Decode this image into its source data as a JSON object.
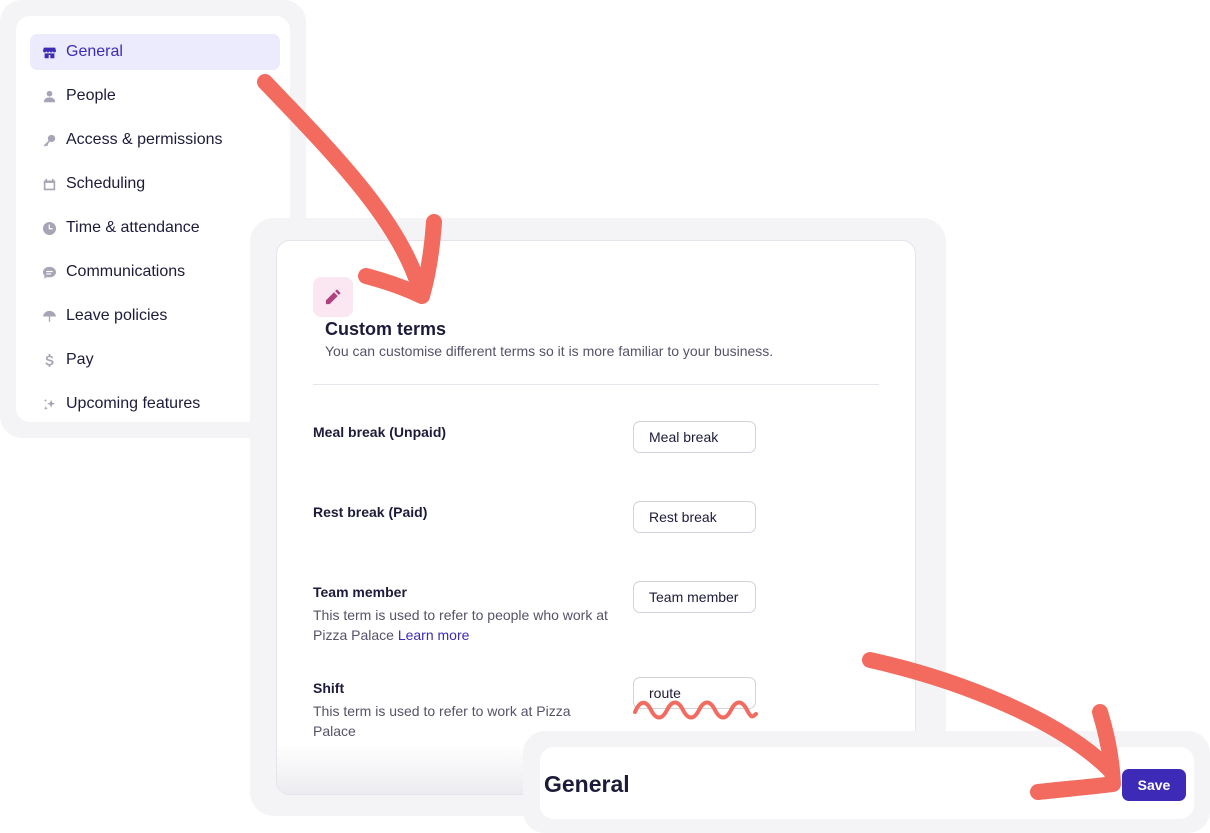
{
  "sidebar": {
    "items": [
      {
        "label": "General",
        "icon": "store-icon",
        "active": true
      },
      {
        "label": "People",
        "icon": "person-icon"
      },
      {
        "label": "Access & permissions",
        "icon": "key-icon"
      },
      {
        "label": "Scheduling",
        "icon": "calendar-icon"
      },
      {
        "label": "Time & attendance",
        "icon": "clock-icon"
      },
      {
        "label": "Communications",
        "icon": "chat-icon"
      },
      {
        "label": "Leave policies",
        "icon": "umbrella-icon"
      },
      {
        "label": "Pay",
        "icon": "dollar-icon"
      },
      {
        "label": "Upcoming features",
        "icon": "sparkle-icon"
      }
    ]
  },
  "custom_terms": {
    "icon": "pencil-icon",
    "title": "Custom terms",
    "subtitle": "You can customise different terms so it is more familiar to your business.",
    "rows": [
      {
        "label": "Meal break (Unpaid)",
        "value": "Meal break"
      },
      {
        "label": "Rest break (Paid)",
        "value": "Rest break"
      },
      {
        "label": "Team member",
        "description": "This term is used to refer to people who work at Pizza Palace",
        "link": "Learn more",
        "value": "Team member"
      },
      {
        "label": "Shift",
        "description": "This term is used to refer to work at Pizza Palace",
        "value": "route"
      }
    ]
  },
  "save_bar": {
    "title": "General",
    "save_label": "Save"
  },
  "colors": {
    "accent": "#3d2bb8",
    "arrow": "#f26b5e",
    "active_bg": "#ecebfd",
    "pencil_bg": "#fbe7f1"
  }
}
